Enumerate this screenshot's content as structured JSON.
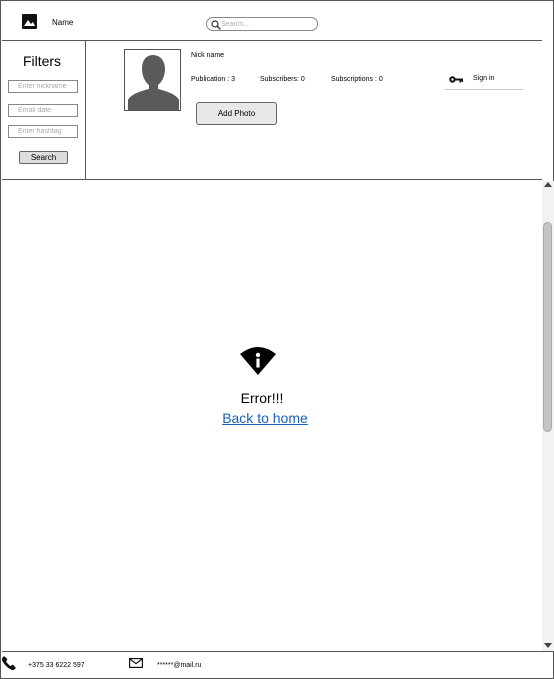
{
  "header": {
    "logo_icon": "image-icon",
    "app_name": "Name",
    "search_placeholder": "Search...",
    "search_icon": "search-icon"
  },
  "filters": {
    "title": "Filters",
    "nickname_placeholder": "Enter nickname",
    "email_placeholder": "Email date",
    "hashtag_placeholder": "Enter hashtag",
    "search_label": "Search"
  },
  "profile": {
    "avatar_icon": "user-silhouette-icon",
    "nickname": "Nick name",
    "publication": "Publication  : 3",
    "subscribers": "Subscribers: 0",
    "subscriptions": "Subscriptions  : 0",
    "add_photo_label": "Add Photo",
    "signin_icon": "key-icon",
    "signin_label": "Sign in"
  },
  "error": {
    "icon": "wifi-info-icon",
    "message": "Error!!!",
    "back_link": "Back to home"
  },
  "footer": {
    "phone_icon": "phone-icon",
    "phone": "+375 33 6222 597",
    "mail_icon": "mail-icon",
    "email": "******@mail.ru"
  }
}
